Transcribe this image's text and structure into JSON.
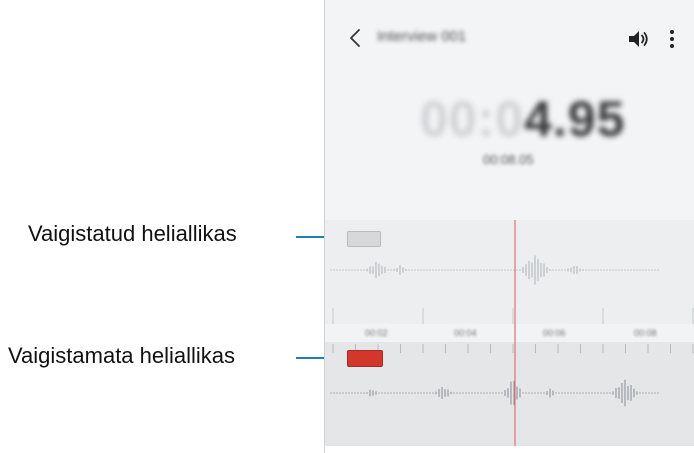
{
  "app": {
    "title": "Interview 001",
    "timer_dim": "00:0",
    "timer_bright": "4.95",
    "sub_time": "00:08.05"
  },
  "icons": {
    "back": "back-arrow-icon",
    "volume": "volume-icon",
    "more": "more-options-icon"
  },
  "timeline": {
    "labels": [
      "00:02",
      "00:04",
      "00:06",
      "00:08"
    ]
  },
  "callouts": {
    "muted_track": "Vaigistatud heliallikas",
    "unmuted_track": "Vaigistamata heliallikas"
  },
  "colors": {
    "playhead": "#e57373",
    "unmuted_badge": "#d3372c",
    "callout_line": "#1f7fb8"
  }
}
